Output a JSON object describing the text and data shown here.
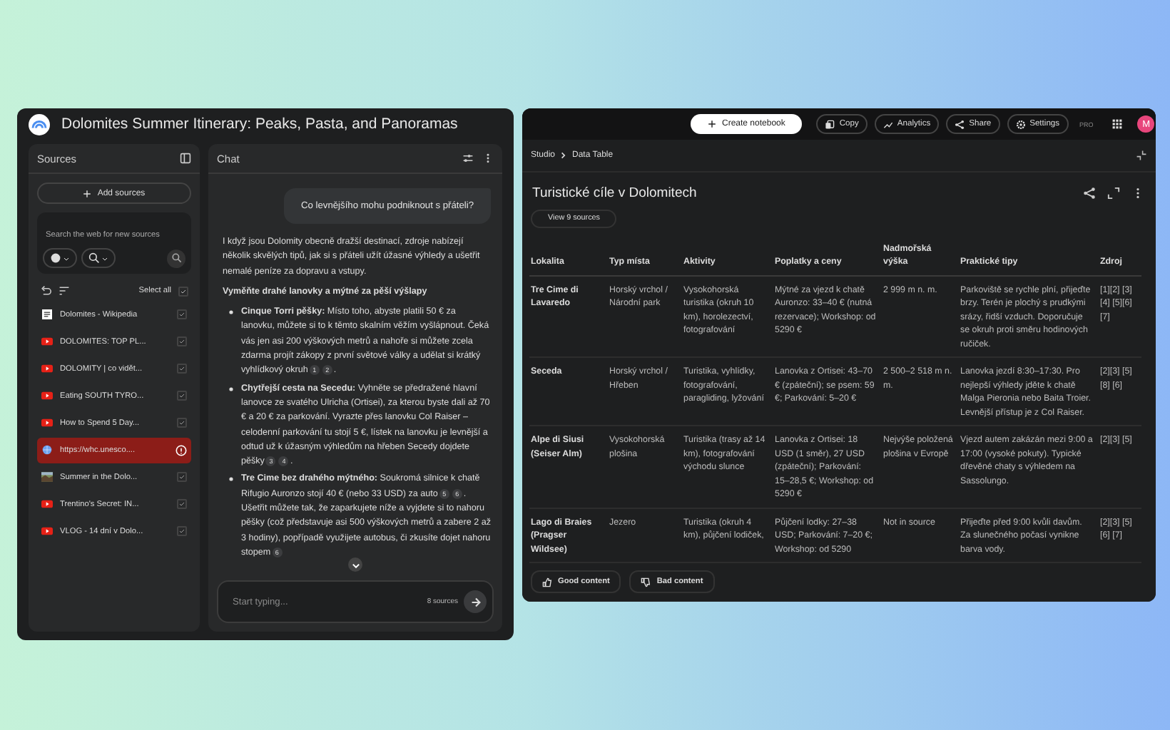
{
  "notebook": {
    "title": "Dolomites Summer Itinerary: Peaks, Pasta, and Panoramas"
  },
  "sources": {
    "title": "Sources",
    "add_button": "Add sources",
    "search_placeholder": "Search the web for new sources",
    "select_all": {
      "label": "Select all",
      "checked": true
    },
    "items": [
      {
        "kind": "wiki",
        "title": "Dolomites - Wikipedia",
        "checked": true,
        "error": false
      },
      {
        "kind": "video",
        "title": "DOLOMITES: TOP PL...",
        "checked": true,
        "error": false
      },
      {
        "kind": "video",
        "title": "DOLOMITY | co vidět...",
        "checked": true,
        "error": false
      },
      {
        "kind": "video",
        "title": "Eating SOUTH TYRO...",
        "checked": true,
        "error": false
      },
      {
        "kind": "video",
        "title": "How to Spend 5 Day...",
        "checked": true,
        "error": false
      },
      {
        "kind": "web",
        "title": "https://whc.unesco....",
        "error": true
      },
      {
        "kind": "image",
        "title": "Summer in the Dolo...",
        "checked": true,
        "error": false
      },
      {
        "kind": "video",
        "title": "Trentino's Secret: IN...",
        "checked": true,
        "error": false
      },
      {
        "kind": "video",
        "title": "VLOG - 14 dní v Dolo...",
        "checked": true,
        "error": false
      }
    ]
  },
  "chat": {
    "title": "Chat",
    "user_message": "Co levnějšího mohu podniknout s přáteli?",
    "intro": "I když jsou Dolomity obecně dražší destinací, zdroje nabízejí několik skvělých tipů, jak si s přáteli užít úžasné výhledy a ušetřit nemalé peníze za dopravu a vstupy.",
    "heading": "Vyměňte drahé lanovky a mýtné za pěší výšlapy",
    "bullets": [
      {
        "segments": [
          {
            "kind": "text",
            "text": "**Cinque Torri pěšky:** Místo toho, abyste platili 50 € za lanovku, můžete si to k těmto skalním věžím vyšlápnout. Čeká vás jen asi 200 výškových metrů a nahoře si můžete zcela zdarma projít zákopy z první světové války a udělat si krátký vyhlídkový okruh"
          },
          {
            "kind": "cite",
            "text": "1"
          },
          {
            "kind": "cite",
            "text": "2"
          },
          {
            "kind": "text",
            "text": "."
          }
        ]
      },
      {
        "segments": [
          {
            "kind": "text",
            "text": "**Chytřejší cesta na Secedu:** Vyhněte se předražené hlavní lanovce ze svatého Ulricha (Ortisei), za kterou byste dali až 70 € a 20 € za parkování. Vyrazte přes lanovku Col Raiser – celodenní parkování tu stojí 5 €, lístek na lanovku je levnější a odtud už k úžasným výhledům na hřeben Secedy dojdete pěšky"
          },
          {
            "kind": "cite",
            "text": "3"
          },
          {
            "kind": "cite",
            "text": "4"
          },
          {
            "kind": "text",
            "text": "."
          }
        ]
      },
      {
        "segments": [
          {
            "kind": "text",
            "text": "**Tre Cime bez drahého mýtného:** Soukromá silnice k chatě Rifugio Auronzo stojí 40 € (nebo 33 USD) za auto"
          },
          {
            "kind": "cite",
            "text": "5"
          },
          {
            "kind": "cite",
            "text": "6"
          },
          {
            "kind": "text",
            "text": ". Ušetřit můžete tak, že zaparkujete níže a vyjdete si to nahoru pěšky (což představuje asi 500 výškových metrů a zabere 2 až 3 hodiny), popřípadě využijete autobus, či zkusíte dojet nahoru stopem"
          },
          {
            "kind": "cite",
            "text": "6"
          }
        ]
      }
    ],
    "input": {
      "placeholder": "Start typing...",
      "source_count": "8 sources"
    }
  },
  "top_bar": {
    "create_button": "Create notebook",
    "buttons": [
      {
        "kind": "copy",
        "label": "Copy"
      },
      {
        "kind": "analytics",
        "label": "Analytics"
      },
      {
        "kind": "share",
        "label": "Share"
      },
      {
        "kind": "settings",
        "label": "Settings"
      }
    ],
    "badge": "PRO",
    "avatar": "M"
  },
  "studio": {
    "breadcrumb": [
      "Studio",
      "Data Table"
    ],
    "title": "Turistické cíle v Dolomitech",
    "sources_button": "View 9 sources",
    "table": {
      "columns": [
        "Lokalita",
        "Typ místa",
        "Aktivity",
        "Poplatky a ceny",
        "Nadmořská výška",
        "Praktické tipy",
        "Zdroj"
      ],
      "rows": [
        [
          "Tre Cime di Lavaredo",
          "Horský vrchol / Národní park",
          "Vysokohorská turistika (okruh 10 km), horolezectví, fotografování",
          "Mýtné za vjezd k chatě Auronzo: 33–40 € (nutná rezervace); Workshop: od 5290 €",
          "2 999 m n. m.",
          "Parkoviště se rychle plní, přijeďte brzy. Terén je plochý s prudkými srázy, řidší vzduch. Doporučuje se okruh proti směru hodinových ručiček.",
          "[1][2] [3][4] [5][6] [7]"
        ],
        [
          "Seceda",
          "Horský vrchol / Hřeben",
          "Turistika, vyhlídky, fotografování, paragliding, lyžování",
          "Lanovka z Ortisei: 43–70 € (zpáteční); se psem: 59 €; Parkování: 5–20 €",
          "2 500–2 518 m n. m.",
          "Lanovka jezdí 8:30–17:30. Pro nejlepší výhledy jděte k chatě Malga Pieronia nebo Baita Troier. Levnější přístup je z Col Raiser.",
          "[2][3] [5][8] [6]"
        ],
        [
          "Alpe di Siusi (Seiser Alm)",
          "Vysokohorská plošina",
          "Turistika (trasy až 14 km), fotografování východu slunce",
          "Lanovka z Ortisei: 18 USD (1 směr), 27 USD (zpáteční); Parkování: 15–28,5 €; Workshop: od 5290 €",
          "Nejvýše položená plošina v Evropě",
          "Vjezd autem zakázán mezi 9:00 a 17:00 (vysoké pokuty). Typické dřevěné chaty s výhledem na Sassolungo.",
          "[2][3] [5]"
        ],
        [
          "Lago di Braies (Pragser Wildsee)",
          "Jezero",
          "Turistika (okruh 4 km), půjčení lodiček,",
          "Půjčení lodky: 27–38 USD; Parkování: 7–20 €; Workshop: od 5290",
          "Not in source",
          "Přijeďte před 9:00 kvůli davům. Za slunečného počasí vynikne barva vody.",
          "[2][3] [5][6] [7]"
        ]
      ]
    },
    "feedback": [
      {
        "kind": "good",
        "label": "Good content"
      },
      {
        "kind": "bad",
        "label": "Bad content"
      }
    ]
  }
}
